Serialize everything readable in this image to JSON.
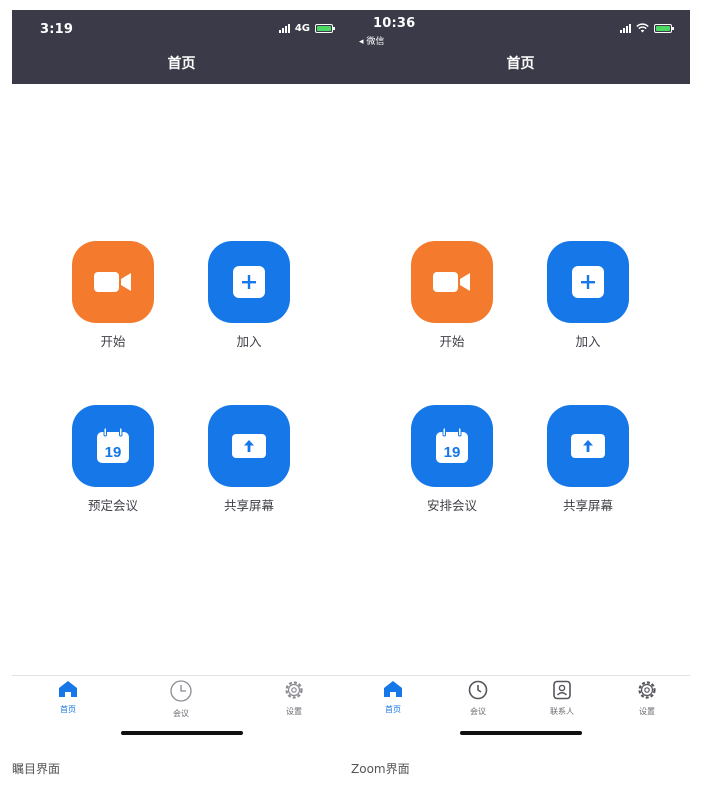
{
  "colors": {
    "nav_bg": "#3a3a48",
    "orange": "#f47a2e",
    "blue": "#1677e8",
    "active_tab": "#1677e8"
  },
  "left": {
    "status": {
      "time": "3:19",
      "network": "4G"
    },
    "nav_title": "首页",
    "tiles": [
      {
        "label": "开始",
        "icon": "video-camera-icon",
        "color": "orange"
      },
      {
        "label": "加入",
        "icon": "plus-icon",
        "color": "blue"
      },
      {
        "label": "预定会议",
        "icon": "calendar-icon",
        "color": "blue",
        "calendar_day": "19"
      },
      {
        "label": "共享屏幕",
        "icon": "share-screen-icon",
        "color": "blue"
      }
    ],
    "tabs": [
      {
        "label": "首页",
        "icon": "home-icon",
        "active": true
      },
      {
        "label": "会议",
        "icon": "clock-icon",
        "active": false
      },
      {
        "label": "设置",
        "icon": "gear-icon",
        "active": false
      }
    ],
    "caption": "瞩目界面"
  },
  "right": {
    "status": {
      "time": "10:36",
      "back_label": "◂ 微信"
    },
    "nav_title": "首页",
    "tiles": [
      {
        "label": "开始",
        "icon": "video-camera-icon",
        "color": "orange"
      },
      {
        "label": "加入",
        "icon": "plus-icon",
        "color": "blue"
      },
      {
        "label": "安排会议",
        "icon": "calendar-icon",
        "color": "blue",
        "calendar_day": "19"
      },
      {
        "label": "共享屏幕",
        "icon": "share-screen-icon",
        "color": "blue"
      }
    ],
    "tabs": [
      {
        "label": "首页",
        "icon": "home-icon",
        "active": true
      },
      {
        "label": "会议",
        "icon": "clock-icon",
        "active": false
      },
      {
        "label": "联系人",
        "icon": "contacts-icon",
        "active": false
      },
      {
        "label": "设置",
        "icon": "gear-icon",
        "active": false
      }
    ],
    "caption": "Zoom界面"
  }
}
